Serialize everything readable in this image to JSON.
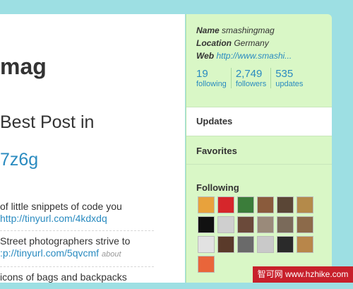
{
  "main": {
    "name_fragment": "mag",
    "tweet_text": "Best Post in",
    "tweet_link": "7z6g",
    "timeline": [
      {
        "text": "of little snippets of code you",
        "link": "http://tinyurl.com/4kdxdq",
        "meta": ""
      },
      {
        "text": "Street photographers strive to",
        "link": ":p://tinyurl.com/5qvcmf",
        "meta": "about"
      },
      {
        "text": "icons of bags and backpacks",
        "link": "",
        "meta": ""
      }
    ]
  },
  "profile": {
    "name_label": "Name",
    "name_value": "smashingmag",
    "location_label": "Location",
    "location_value": "Germany",
    "web_label": "Web",
    "web_value": "http://www.smashi..."
  },
  "stats": [
    {
      "number": "19",
      "label": "following"
    },
    {
      "number": "2,749",
      "label": "followers"
    },
    {
      "number": "535",
      "label": "updates"
    }
  ],
  "sidebar": {
    "updates_label": "Updates",
    "favorites_label": "Favorites",
    "following_label": "Following"
  },
  "avatars": [
    {
      "name": "avatar-1",
      "color": "#e8a23c"
    },
    {
      "name": "avatar-swiss",
      "color": "#d6262b"
    },
    {
      "name": "avatar-santa",
      "color": "#3b7d3a"
    },
    {
      "name": "avatar-4",
      "color": "#8a5b3c"
    },
    {
      "name": "avatar-5",
      "color": "#5a4636"
    },
    {
      "name": "avatar-6",
      "color": "#b48a4a"
    },
    {
      "name": "avatar-spade",
      "color": "#111111"
    },
    {
      "name": "avatar-8",
      "color": "#cfcfcf"
    },
    {
      "name": "avatar-9",
      "color": "#6b4a3a"
    },
    {
      "name": "avatar-10",
      "color": "#9a8a7a"
    },
    {
      "name": "avatar-11",
      "color": "#7a6a5a"
    },
    {
      "name": "avatar-12",
      "color": "#8c6a4a"
    },
    {
      "name": "avatar-13",
      "color": "#e2e2e2"
    },
    {
      "name": "avatar-14",
      "color": "#5a3a2a"
    },
    {
      "name": "avatar-15",
      "color": "#6a6a6a"
    },
    {
      "name": "avatar-16",
      "color": "#c9c9c9"
    },
    {
      "name": "avatar-17",
      "color": "#2a2a2a"
    },
    {
      "name": "avatar-18",
      "color": "#b8864a"
    },
    {
      "name": "avatar-19",
      "color": "#e9653a"
    }
  ],
  "watermark": "智可网 www.hzhike.com"
}
